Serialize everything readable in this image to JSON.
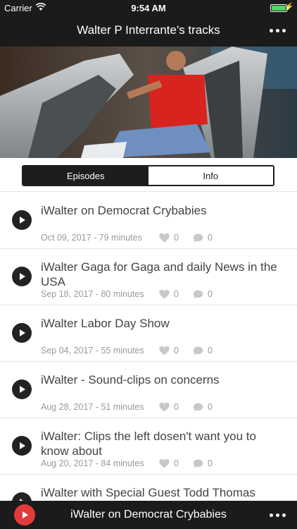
{
  "status": {
    "carrier": "Carrier",
    "time": "9:54 AM",
    "battery_level": 1.0
  },
  "header": {
    "title": "Walter P Interrante's tracks",
    "more_icon": "more-dots-icon"
  },
  "hero": {
    "description_icon": "cover-photo"
  },
  "tabs": [
    {
      "label": "Episodes",
      "active": true
    },
    {
      "label": "Info",
      "active": false
    }
  ],
  "episodes": [
    {
      "title": "iWalter on Democrat Crybabies",
      "meta": "Oct 09, 2017 - 79 minutes",
      "likes": "0",
      "comments": "0"
    },
    {
      "title": "iWalter Gaga for Gaga and daily News in the USA",
      "meta": "Sep 18, 2017 - 80 minutes",
      "likes": "0",
      "comments": "0"
    },
    {
      "title": "iWalter Labor Day Show",
      "meta": "Sep 04, 2017 - 55 minutes",
      "likes": "0",
      "comments": "0"
    },
    {
      "title": "iWalter - Sound-clips on concerns",
      "meta": "Aug 28, 2017 - 51 minutes",
      "likes": "0",
      "comments": "0"
    },
    {
      "title": "iWalter: Clips the left dosen't want you to know about",
      "meta": "Aug 20, 2017 - 84 minutes",
      "likes": "0",
      "comments": "0"
    },
    {
      "title": "iWalter with Special Guest Todd Thomas",
      "meta": "",
      "likes": "",
      "comments": ""
    }
  ],
  "player": {
    "now_playing": "iWalter on Democrat Crybabies",
    "accent_color": "#e23b3b"
  },
  "colors": {
    "bar_background": "#1b1b1b",
    "text_primary": "#444444",
    "text_secondary": "#9a9a9a"
  }
}
